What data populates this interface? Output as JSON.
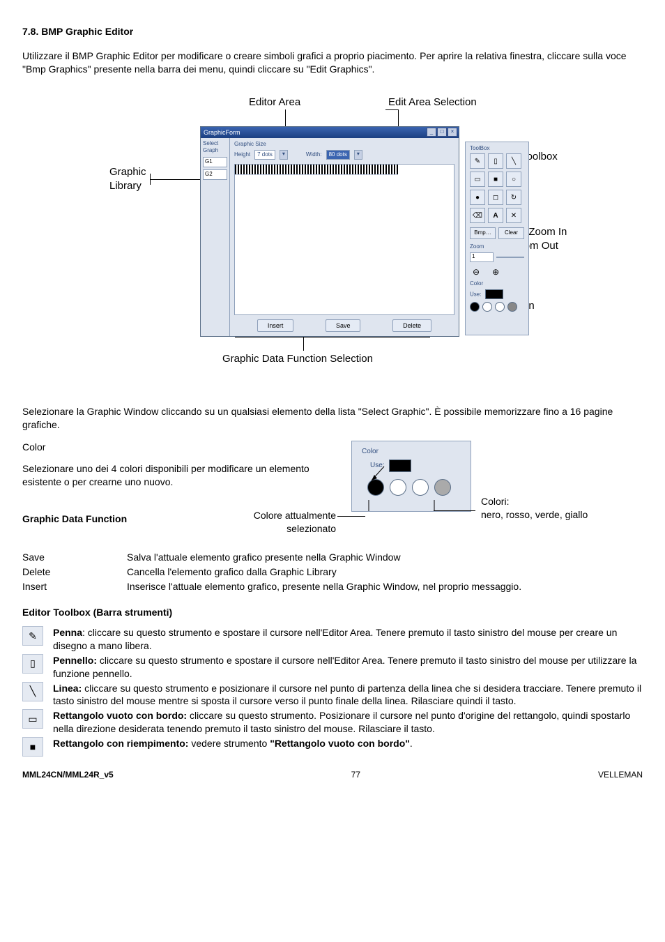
{
  "heading": "7.8.   BMP Graphic Editor",
  "intro": "Utilizzare il BMP Graphic Editor per modificare o creare simboli grafici a proprio piacimento. Per aprire la relativa finestra, cliccare sulla voce \"Bmp Graphics\" presente nella barra dei menu, quindi cliccare su \"Edit Graphics\".",
  "diagram": {
    "callouts": {
      "editor_area": "Editor Area",
      "edit_area_selection": "Edit Area Selection",
      "graphic_library": "Graphic\nLibrary",
      "editor_toolbox": "Editor Toolbox",
      "display_zoom": "Display Zoom In\nand Zoom Out",
      "colour_selection": "Colour\nSelection",
      "graphic_data_fn": "Graphic Data Function Selection"
    },
    "window": {
      "title": "GraphicForm",
      "btn_min": "_",
      "btn_max": "□",
      "btn_close": "×",
      "sidebar_title": "Select Graph",
      "sidebar_items": [
        "G1",
        "G2"
      ],
      "size_label": "Graphic Size",
      "height_lbl": "Height",
      "height_val": "7 dots",
      "width_lbl": "Width:",
      "width_val": "80 dots",
      "dd": "▾",
      "btn_insert": "Insert",
      "btn_save": "Save",
      "btn_delete": "Delete"
    },
    "toolbox": {
      "title": "ToolBox",
      "cells": [
        "✎",
        "▯",
        "╲",
        "▭",
        "■",
        "○",
        "●",
        "◻",
        "↻",
        "⌫",
        "A",
        "✕"
      ],
      "btn_bmp": "Bmp…",
      "btn_clear": "Clear",
      "zoom_lbl": "Zoom",
      "zoom_val": "1",
      "mag_out": "⊖",
      "mag_in": "⊕",
      "color_lbl": "Color",
      "use_lbl": "Use:"
    }
  },
  "after_diagram": "Selezionare la Graphic Window cliccando su un qualsiasi elemento della lista \"Select Graphic\". È possibile memorizzare fino a 16 pagine grafiche.",
  "color_section": {
    "title": "Color",
    "body": "Selezionare uno dei 4 colori disponibili per modificare un elemento esistente o per crearne uno nuovo.",
    "panel_hdr": "Color",
    "panel_use": "Use:",
    "lbl_current": "Colore attualmente selezionato",
    "lbl_colors_head": "Colori:",
    "lbl_colors_body": "nero, rosso, verde, giallo"
  },
  "data_fn": {
    "title": "Graphic Data Function",
    "rows": [
      {
        "k": "Save",
        "v": "Salva l'attuale elemento grafico presente nella Graphic Window"
      },
      {
        "k": "Delete",
        "v": "Cancella l'elemento grafico dalla Graphic Library"
      },
      {
        "k": "Insert",
        "v": "Inserisce l'attuale elemento grafico, presente nella Graphic Window, nel proprio messaggio."
      }
    ]
  },
  "toolbox_section": {
    "title": "Editor Toolbox (Barra strumenti)",
    "rows": [
      {
        "icon": "✎",
        "name": "pen-icon",
        "bold": "Penna",
        "sep": ": ",
        "text": "cliccare su questo strumento e spostare il cursore nell'Editor Area. Tenere premuto il tasto sinistro del mouse per creare un disegno a mano libera."
      },
      {
        "icon": "▯",
        "name": "brush-icon",
        "bold": "Pennello:",
        "sep": " ",
        "text": "cliccare su questo strumento e spostare il cursore nell'Editor Area. Tenere premuto il tasto sinistro del mouse per utilizzare la funzione pennello."
      },
      {
        "icon": "╲",
        "name": "line-icon",
        "bold": "Linea:",
        "sep": " ",
        "text": "cliccare su questo strumento e posizionare il cursore nel punto di partenza della linea che si desidera tracciare. Tenere premuto il tasto sinistro del mouse mentre si sposta il cursore verso il punto finale della linea. Rilasciare quindi il tasto."
      },
      {
        "icon": "▭",
        "name": "rect-outline-icon",
        "bold": "Rettangolo vuoto con bordo:",
        "sep": " ",
        "text": "cliccare su questo strumento. Posizionare il cursore nel punto d'origine del rettangolo, quindi spostarlo nella direzione desiderata tenendo premuto il tasto sinistro del mouse. Rilasciare il tasto."
      },
      {
        "icon": "■",
        "name": "rect-filled-icon",
        "bold": "Rettangolo con riempimento:",
        "sep": " ",
        "text_pre": "vedere strumento ",
        "text_bold2": "\"Rettangolo vuoto con bordo\"",
        "text_post": "."
      }
    ]
  },
  "footer": {
    "left": "MML24CN/MML24R_v5",
    "center": "77",
    "right": "VELLEMAN"
  }
}
